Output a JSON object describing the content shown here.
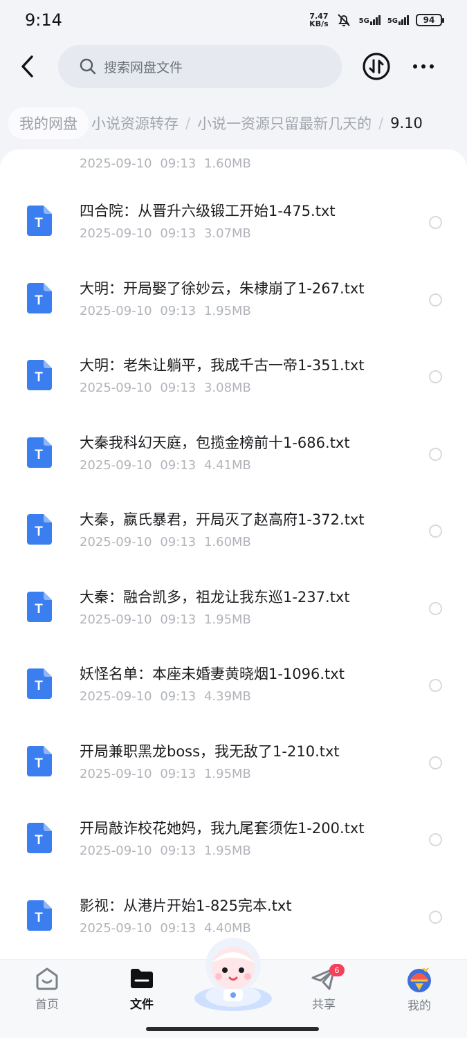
{
  "status_bar": {
    "time": "9:14",
    "net_speed_value": "7.47",
    "net_speed_unit": "KB/s",
    "network_1": "5G",
    "network_2": "5G",
    "battery": "94"
  },
  "header": {
    "search_placeholder": "搜索网盘文件"
  },
  "breadcrumb": {
    "root": "我的网盘",
    "items": [
      "小说资源转存",
      "小说一资源只留最新几天的"
    ],
    "current": "9.10"
  },
  "partial_file": {
    "date": "2025-09-10",
    "time": "09:13",
    "size": "1.60MB"
  },
  "files": [
    {
      "name": "四合院：从晋升六级锻工开始1-475.txt",
      "date": "2025-09-10",
      "time": "09:13",
      "size": "3.07MB"
    },
    {
      "name": "大明：开局娶了徐妙云，朱棣崩了1-267.txt",
      "date": "2025-09-10",
      "time": "09:13",
      "size": "1.95MB"
    },
    {
      "name": "大明：老朱让躺平，我成千古一帝1-351.txt",
      "date": "2025-09-10",
      "time": "09:13",
      "size": "3.08MB"
    },
    {
      "name": "大秦我科幻天庭，包揽金榜前十1-686.txt",
      "date": "2025-09-10",
      "time": "09:13",
      "size": "4.41MB"
    },
    {
      "name": "大秦，嬴氏暴君，开局灭了赵高府1-372.txt",
      "date": "2025-09-10",
      "time": "09:13",
      "size": "1.60MB"
    },
    {
      "name": "大秦：融合凯多，祖龙让我东巡1-237.txt",
      "date": "2025-09-10",
      "time": "09:13",
      "size": "1.95MB"
    },
    {
      "name": "妖怪名单：本座未婚妻黄晓烟1-1096.txt",
      "date": "2025-09-10",
      "time": "09:13",
      "size": "4.39MB"
    },
    {
      "name": "开局兼职黑龙boss，我无敌了1-210.txt",
      "date": "2025-09-10",
      "time": "09:13",
      "size": "1.95MB"
    },
    {
      "name": "开局敲诈校花她妈，我九尾套须佐1-200.txt",
      "date": "2025-09-10",
      "time": "09:13",
      "size": "1.95MB"
    },
    {
      "name": "影视：从港片开始1-825完本.txt",
      "date": "2025-09-10",
      "time": "09:13",
      "size": "4.40MB"
    }
  ],
  "file_icon_letter": "T",
  "bottom_nav": {
    "home": "首页",
    "files": "文件",
    "share": "共享",
    "share_badge": "6",
    "mine": "我的"
  },
  "colors": {
    "file_icon": "#3a7ef0",
    "badge": "#f4405a"
  }
}
